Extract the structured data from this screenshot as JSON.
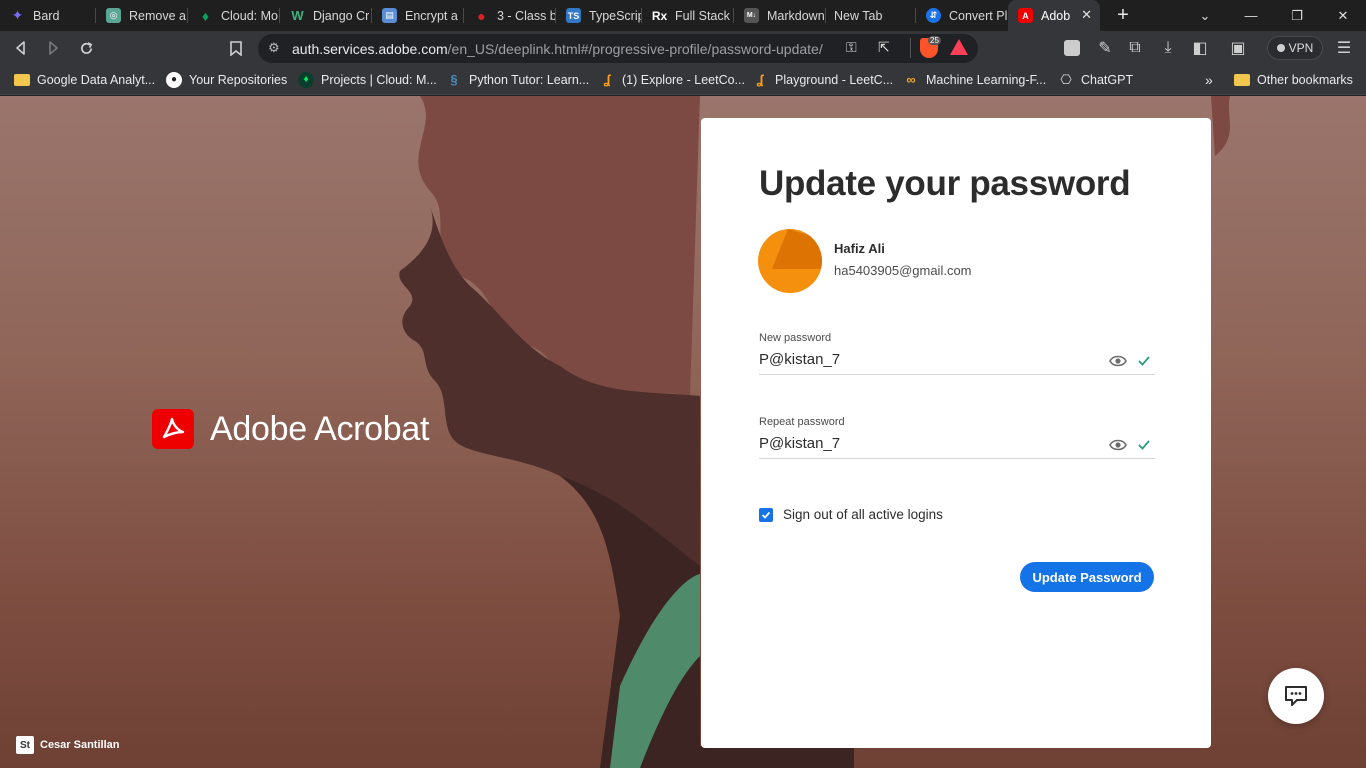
{
  "browser": {
    "tabs": [
      {
        "label": "Bard",
        "icon": "bard-icon",
        "color": "#7b6cf6"
      },
      {
        "label": "Remove a",
        "icon": "chatgpt-icon",
        "color": "#5aa593"
      },
      {
        "label": "Cloud: Mo",
        "icon": "mongodb-icon",
        "color": "#00a35c"
      },
      {
        "label": "Django Cr",
        "icon": "w-icon",
        "color": "#3fb27f"
      },
      {
        "label": "Encrypt a",
        "icon": "doc-icon",
        "color": "#5b8dd6"
      },
      {
        "label": "3 - Class b",
        "icon": "youtube-icon",
        "color": "#e02020"
      },
      {
        "label": "TypeScript",
        "icon": "ts-icon",
        "color": "#3178c6"
      },
      {
        "label": "Full Stack",
        "icon": "rx-icon",
        "color": "#2b2b2b"
      },
      {
        "label": "Markdown",
        "icon": "markdown-icon",
        "color": "#555555"
      },
      {
        "label": "New Tab",
        "icon": "",
        "color": ""
      },
      {
        "label": "Convert Pl",
        "icon": "convert-icon",
        "color": "#1a73e8"
      },
      {
        "label": "Adob",
        "icon": "adobe-icon",
        "color": "#e00000"
      }
    ],
    "address": {
      "domain": "auth.services.adobe.com",
      "path": "/en_US/deeplink.html#/progressive-profile/password-update/"
    },
    "brave_badge": "25",
    "vpn_label": "VPN",
    "bookmarks": [
      {
        "label": "Google Data Analyt...",
        "icon": "folder-icon"
      },
      {
        "label": "Your Repositories",
        "icon": "github-icon"
      },
      {
        "label": "Projects | Cloud: M...",
        "icon": "mongodb-icon"
      },
      {
        "label": "Python Tutor: Learn...",
        "icon": "python-icon"
      },
      {
        "label": "(1) Explore - LeetCo...",
        "icon": "leetcode-icon"
      },
      {
        "label": "Playground - LeetC...",
        "icon": "leetcode-icon"
      },
      {
        "label": "Machine Learning-F...",
        "icon": "coursera-icon"
      },
      {
        "label": "ChatGPT",
        "icon": "chatgpt-icon"
      }
    ],
    "more_bookmarks": "»",
    "other_bookmarks": "Other bookmarks"
  },
  "page": {
    "brand_name": "Adobe Acrobat",
    "photo_credit": "Cesar Santillan",
    "photo_credit_badge": "St",
    "card": {
      "title": "Update your password",
      "user_name": "Hafiz Ali",
      "user_email": "ha5403905@gmail.com",
      "new_password_label": "New password",
      "new_password_value": "P@kistan_7",
      "repeat_password_label": "Repeat password",
      "repeat_password_value": "P@kistan_7",
      "sign_out_label": "Sign out of all active logins",
      "sign_out_checked": true,
      "submit_label": "Update Password"
    }
  },
  "colors": {
    "accent_blue": "#1473e6",
    "adobe_red": "#e00000",
    "valid_green": "#2d9d78",
    "avatar_orange": "#f5900f"
  }
}
